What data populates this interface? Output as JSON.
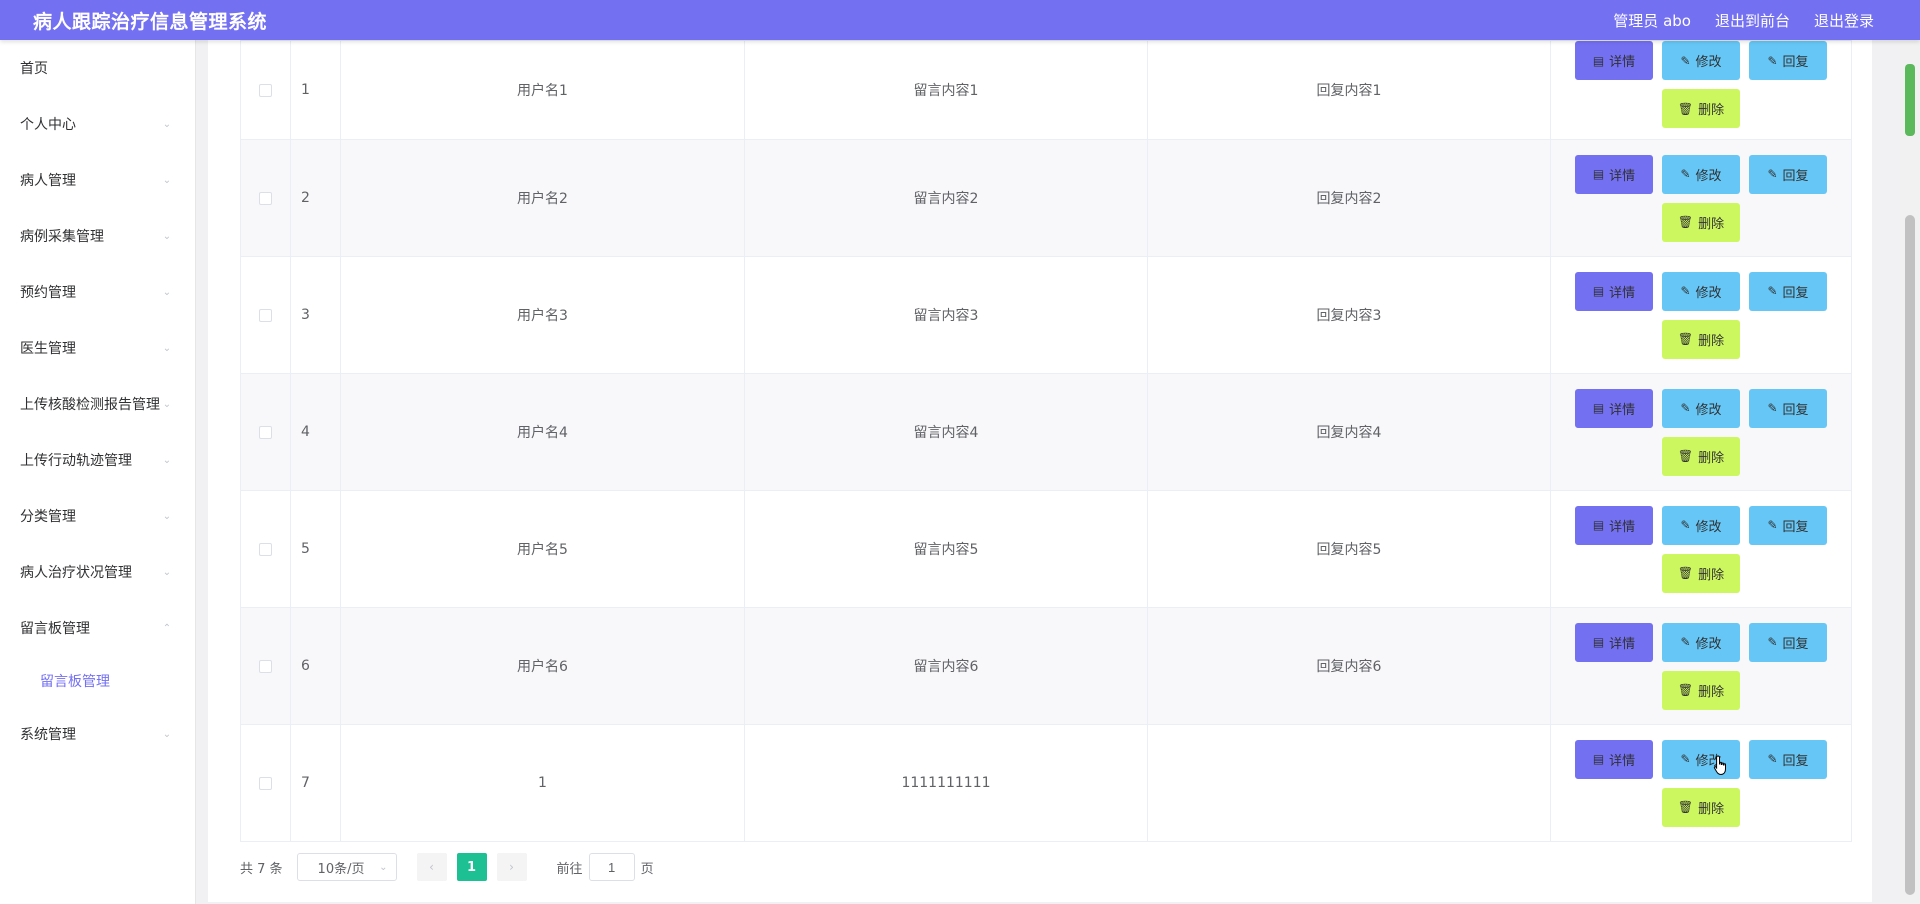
{
  "header": {
    "title": "病人跟踪治疗信息管理系统",
    "user": "管理员 abo",
    "to_front": "退出到前台",
    "logout": "退出登录"
  },
  "sidebar": {
    "items": [
      {
        "label": "首页",
        "has_chevron": false
      },
      {
        "label": "个人中心",
        "has_chevron": true
      },
      {
        "label": "病人管理",
        "has_chevron": true
      },
      {
        "label": "病例采集管理",
        "has_chevron": true
      },
      {
        "label": "预约管理",
        "has_chevron": true
      },
      {
        "label": "医生管理",
        "has_chevron": true
      },
      {
        "label": "上传核酸检测报告管理",
        "has_chevron": true
      },
      {
        "label": "上传行动轨迹管理",
        "has_chevron": true
      },
      {
        "label": "分类管理",
        "has_chevron": true
      },
      {
        "label": "病人治疗状况管理",
        "has_chevron": true
      },
      {
        "label": "留言板管理",
        "has_chevron": true,
        "expanded": true
      },
      {
        "label": "系统管理",
        "has_chevron": true
      }
    ],
    "sub_item": "留言板管理"
  },
  "table": {
    "rows": [
      {
        "index": "1",
        "username": "用户名1",
        "message": "留言内容1",
        "reply": "回复内容1"
      },
      {
        "index": "2",
        "username": "用户名2",
        "message": "留言内容2",
        "reply": "回复内容2"
      },
      {
        "index": "3",
        "username": "用户名3",
        "message": "留言内容3",
        "reply": "回复内容3"
      },
      {
        "index": "4",
        "username": "用户名4",
        "message": "留言内容4",
        "reply": "回复内容4"
      },
      {
        "index": "5",
        "username": "用户名5",
        "message": "留言内容5",
        "reply": "回复内容5"
      },
      {
        "index": "6",
        "username": "用户名6",
        "message": "留言内容6",
        "reply": "回复内容6"
      },
      {
        "index": "7",
        "username": "1",
        "message": "1111111111",
        "reply": ""
      }
    ],
    "actions": {
      "detail": "详情",
      "edit": "修改",
      "reply": "回复",
      "delete": "删除"
    }
  },
  "pager": {
    "total": "共 7 条",
    "page_size": "10条/页",
    "current_page": "1",
    "goto_prefix": "前往",
    "goto_value": "1",
    "goto_suffix": "页"
  },
  "icons": {
    "detail": "document-icon",
    "edit": "pencil-icon",
    "reply": "pencil-icon",
    "delete": "trash-icon",
    "chevron": "chevron-down-icon"
  },
  "colors": {
    "header": "#7470f2",
    "detail": "#7470f2",
    "edit": "#66c7f6",
    "delete": "#cdf75e",
    "page_active": "#1dc092"
  }
}
